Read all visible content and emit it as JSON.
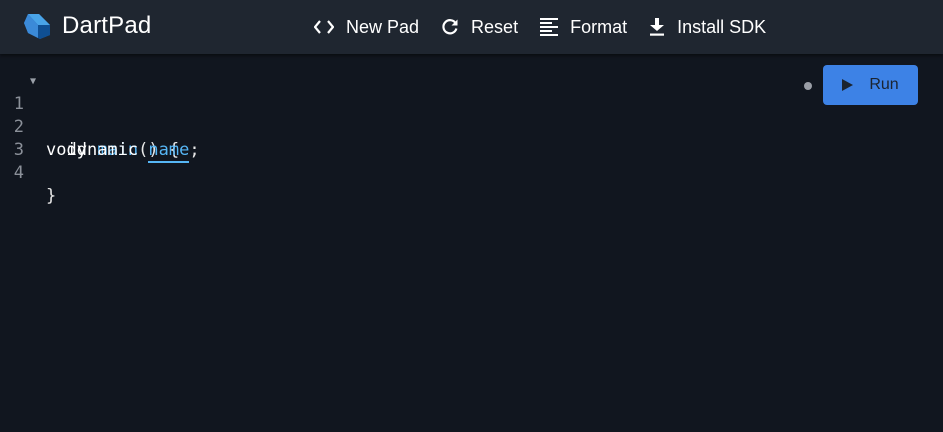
{
  "app": {
    "title": "DartPad"
  },
  "toolbar": {
    "new_pad_label": "New Pad",
    "reset_label": "Reset",
    "format_label": "Format",
    "install_sdk_label": "Install SDK"
  },
  "editor": {
    "lines": [
      {
        "number": "1"
      },
      {
        "number": "2"
      },
      {
        "number": "3"
      },
      {
        "number": "4"
      }
    ],
    "tokens": {
      "void": "void",
      "main": "main",
      "paren_brace": "() {",
      "indent": "  ",
      "dynamic": "dynamic ",
      "name": "name",
      "semicolon": ";",
      "close_brace": "}"
    }
  },
  "run_panel": {
    "run_label": "Run"
  },
  "colors": {
    "background": "#11161f",
    "topbar": "#1f2630",
    "accent": "#3d82e6",
    "identifier": "#56b6f5"
  }
}
